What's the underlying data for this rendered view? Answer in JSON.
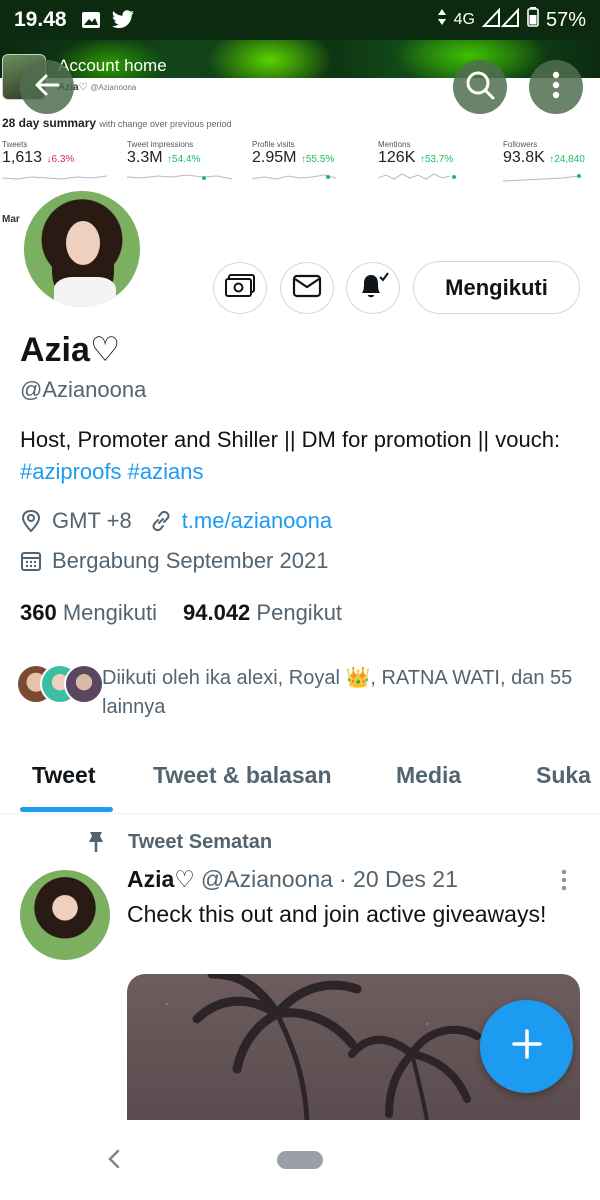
{
  "status_bar": {
    "time": "19.48",
    "network": "4G",
    "battery": "57%"
  },
  "banner": {
    "account_home": "Account home",
    "account_name": "Azia♡",
    "account_handle": "@Azianoona",
    "summary_title": "28 day summary",
    "summary_subtitle": "with change over previous period",
    "metrics": [
      {
        "label": "Tweets",
        "value": "1,613",
        "change": "↓6.3%",
        "direction": "down"
      },
      {
        "label": "Tweet impressions",
        "value": "3.3M",
        "change": "↑54.4%",
        "direction": "up"
      },
      {
        "label": "Profile visits",
        "value": "2.95M",
        "change": "↑55.5%",
        "direction": "up"
      },
      {
        "label": "Mentions",
        "value": "126K",
        "change": "↑53.7%",
        "direction": "up"
      },
      {
        "label": "Followers",
        "value": "93.8K",
        "change": "↑24,840",
        "direction": "up"
      }
    ],
    "month_label": "Mar"
  },
  "profile": {
    "display_name": "Azia♡",
    "handle": "@Azianoona",
    "bio_text": "Host, Promoter and Shiller || DM for promotion || vouch: ",
    "bio_tag_1": "#aziproofs",
    "bio_tag_2": "#azians",
    "location": "GMT +8",
    "link": "t.me/azianoona",
    "joined": "Bergabung September 2021",
    "following_count": "360",
    "following_label": "Mengikuti",
    "followers_count": "94.042",
    "followers_label": "Pengikut",
    "followed_by": "Diikuti oleh ika alexi, Royal 👑, RATNA WATI, dan 55 lainnya",
    "follow_button": "Mengikuti"
  },
  "tabs": [
    {
      "label": "Tweet",
      "active": true
    },
    {
      "label": "Tweet & balasan",
      "active": false
    },
    {
      "label": "Media",
      "active": false
    },
    {
      "label": "Suka",
      "active": false
    }
  ],
  "pinned_tweet": {
    "pinned_label": "Tweet Sematan",
    "author_name": "Azia♡",
    "author_handle": "@Azianoona",
    "date": "· 20 Des 21",
    "text": "Check this out and join active giveaways!"
  },
  "colors": {
    "accent": "#1d9bf0",
    "status_bar": "#0b2a10"
  },
  "icons": [
    "back-arrow-icon",
    "search-icon",
    "more-vertical-icon",
    "money-icon",
    "mail-icon",
    "bell-icon",
    "location-icon",
    "link-icon",
    "calendar-icon",
    "pin-icon",
    "plus-icon"
  ]
}
